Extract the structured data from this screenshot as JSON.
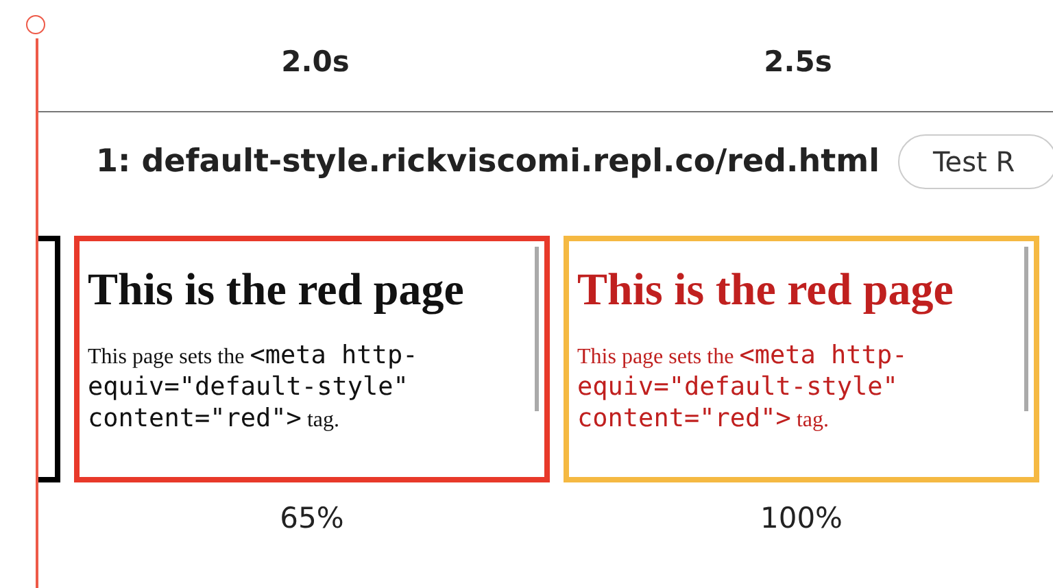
{
  "timeline": {
    "ticks": [
      "2.0s",
      "2.5s"
    ]
  },
  "test": {
    "title": "1: default-style.rickviscomi.repl.co/red.html",
    "button": "Test R"
  },
  "frames": [
    {
      "kind": "partial",
      "color": "#000000"
    },
    {
      "kind": "full",
      "color": "#e8392a",
      "styled": false,
      "heading": "This is the red page",
      "paragraph": {
        "before": "This page sets the ",
        "code": "<meta http-equiv=\"default-style\" content=\"red\">",
        "after": " tag."
      },
      "caption": "65%"
    },
    {
      "kind": "full",
      "color": "#f5b942",
      "styled": true,
      "heading": "This is the red page",
      "paragraph": {
        "before": "This page sets the ",
        "code": "<meta http-equiv=\"default-style\" content=\"red\">",
        "after": " tag."
      },
      "caption": "100%"
    }
  ]
}
